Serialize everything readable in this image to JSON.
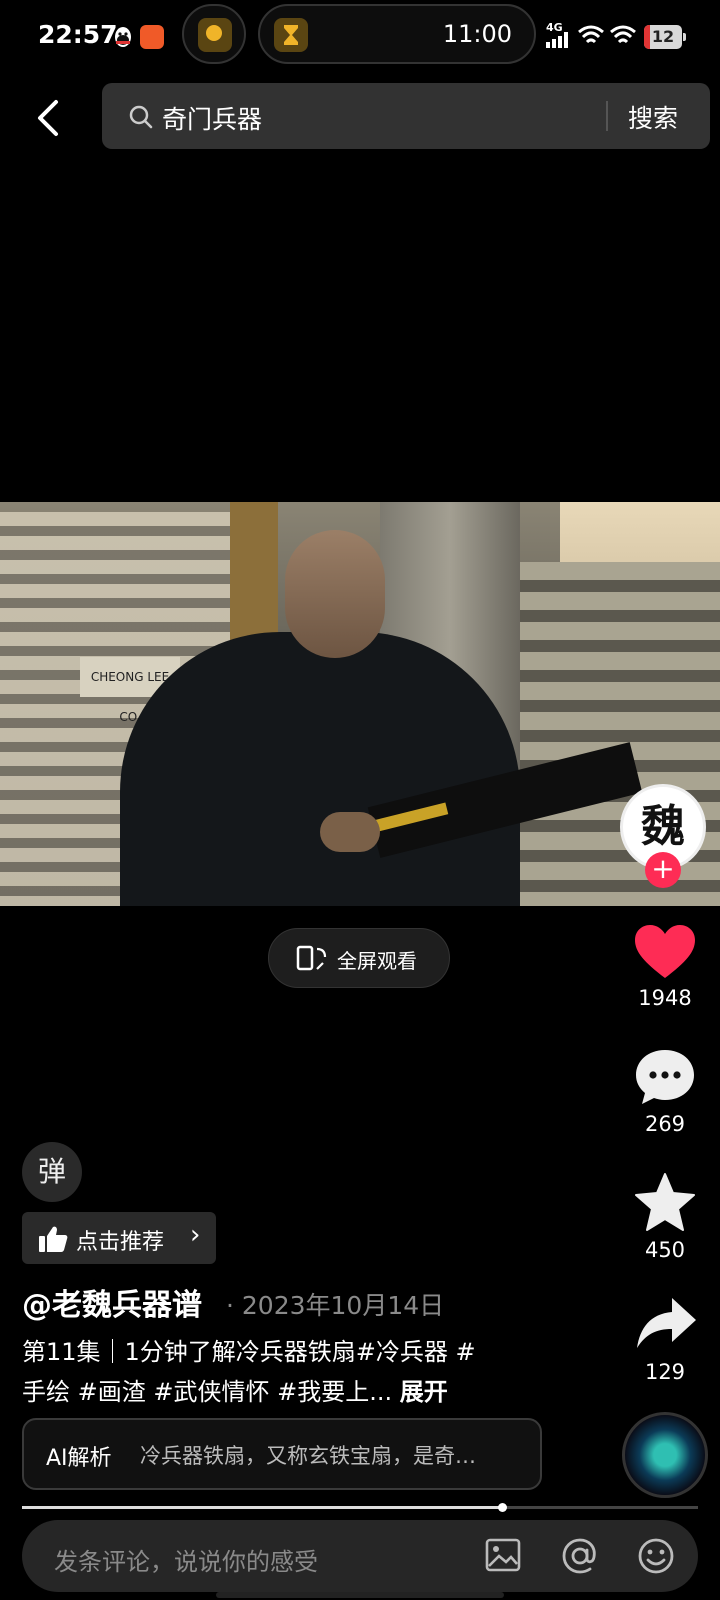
{
  "status_bar": {
    "time": "22:57",
    "clock_pill": "11:00",
    "network": "4G",
    "battery": "12"
  },
  "search": {
    "query": "奇门兵器",
    "button": "搜索"
  },
  "video": {
    "sign_text": "CHEONG LEE CO."
  },
  "fullscreen": {
    "label": "全屏观看"
  },
  "rail": {
    "author_avatar_char": "魏",
    "likes": "1948",
    "comments": "269",
    "favorites": "450",
    "shares": "129"
  },
  "danmaku": {
    "label": "弹"
  },
  "recommend": {
    "label": "点击推荐"
  },
  "post": {
    "author": "@老魏兵器谱",
    "date": "· 2023年10月14日",
    "caption_line1": "第11集｜1分钟了解冷兵器铁扇#冷兵器 #",
    "caption_line2": "手绘 #画渣 #武侠情怀 #我要上...",
    "expand": "展开"
  },
  "ai": {
    "label": "AI解析",
    "summary": "冷兵器铁扇，又称玄铁宝扇，是奇…"
  },
  "progress": {
    "fraction": 0.71
  },
  "comment": {
    "placeholder": "发条评论，说说你的感受"
  },
  "colors": {
    "like": "#fe2c55",
    "accent_plus": "#fe2c55",
    "timer_icon": "#f0b429"
  },
  "icons": [
    "back-icon",
    "search-icon",
    "heart-icon",
    "comment-icon",
    "star-icon",
    "share-icon",
    "thumbs-up-icon",
    "image-icon",
    "at-icon",
    "emoji-icon",
    "fullscreen-icon"
  ]
}
